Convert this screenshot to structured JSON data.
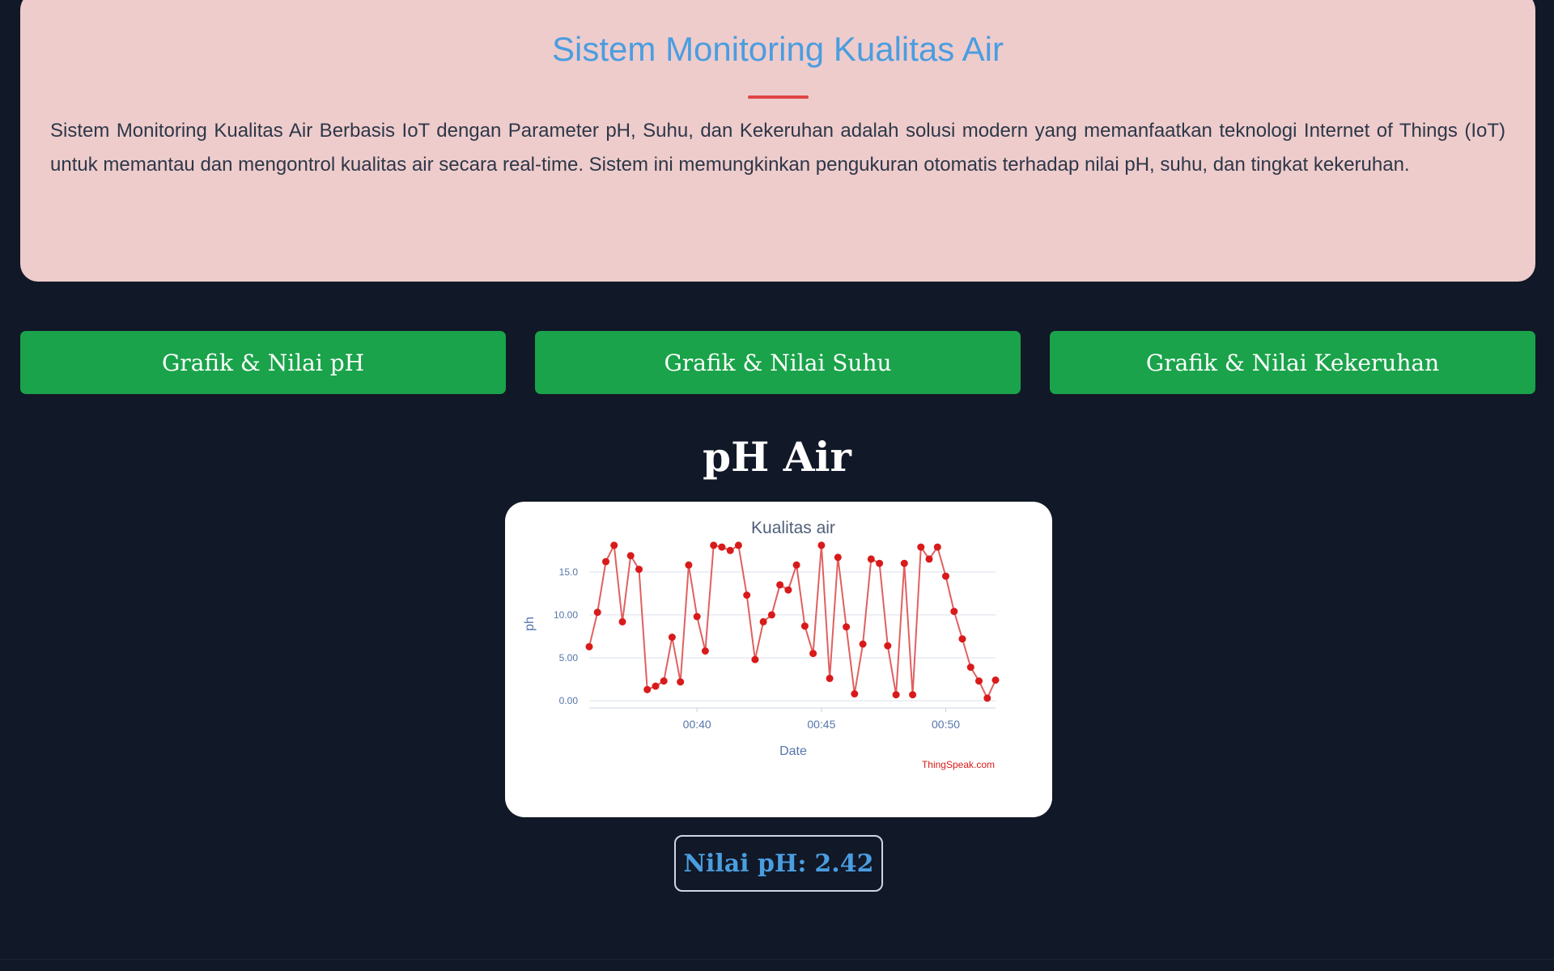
{
  "hero": {
    "title": "Sistem Monitoring Kualitas Air",
    "description": "Sistem Monitoring Kualitas Air Berbasis IoT dengan Parameter pH, Suhu, dan Kekeruhan adalah solusi modern yang memanfaatkan teknologi Internet of Things (IoT) untuk memantau dan mengontrol kualitas air secara real-time. Sistem ini memungkinkan pengukuran otomatis terhadap nilai pH, suhu, dan tingkat kekeruhan."
  },
  "tabs": [
    {
      "label": "Grafik & Nilai pH"
    },
    {
      "label": "Grafik & Nilai Suhu"
    },
    {
      "label": "Grafik & Nilai Kekeruhan"
    }
  ],
  "section": {
    "title": "pH Air"
  },
  "value": {
    "label": "Nilai pH:",
    "reading": "2.42"
  },
  "chart_data": {
    "type": "line",
    "title": "Kualitas air",
    "xlabel": "Date",
    "ylabel": "ph",
    "credit": "ThingSpeak.com",
    "line_color": "#e06060",
    "marker_color": "#d91a1a",
    "grid": true,
    "ylim": [
      0,
      18
    ],
    "yticks": [
      0,
      5,
      10,
      15
    ],
    "ytick_labels": [
      "0.00",
      "5.00",
      "10.00",
      "15.0"
    ],
    "xlim": [
      "00:35:40",
      "00:52:00"
    ],
    "xticks": [
      "00:40:00",
      "00:45:00",
      "00:50:00"
    ],
    "xtick_labels": [
      "00:40",
      "00:45",
      "00:50"
    ],
    "series": [
      {
        "x": [
          "00:35:40",
          "00:36:00",
          "00:36:20",
          "00:36:40",
          "00:37:00",
          "00:37:20",
          "00:37:40",
          "00:38:00",
          "00:38:20",
          "00:38:40",
          "00:39:00",
          "00:39:20",
          "00:39:40",
          "00:40:00",
          "00:40:20",
          "00:40:40",
          "00:41:00",
          "00:41:20",
          "00:41:40",
          "00:42:00",
          "00:42:20",
          "00:42:40",
          "00:43:00",
          "00:43:20",
          "00:43:40",
          "00:44:00",
          "00:44:20",
          "00:44:40",
          "00:45:00",
          "00:45:20",
          "00:45:40",
          "00:46:00",
          "00:46:20",
          "00:46:40",
          "00:47:00",
          "00:47:20",
          "00:47:40",
          "00:48:00",
          "00:48:20",
          "00:48:40",
          "00:49:00",
          "00:49:20",
          "00:49:40",
          "00:50:00",
          "00:50:20",
          "00:50:40",
          "00:51:00",
          "00:51:20",
          "00:51:40",
          "00:52:00"
        ],
        "y": [
          6.3,
          10.3,
          16.2,
          18.1,
          9.2,
          16.9,
          15.3,
          1.3,
          1.7,
          2.3,
          7.4,
          2.2,
          15.8,
          9.8,
          5.8,
          18.1,
          17.9,
          17.5,
          18.1,
          12.3,
          4.8,
          9.2,
          10.0,
          13.5,
          12.9,
          15.8,
          8.7,
          5.5,
          18.1,
          2.6,
          16.7,
          8.6,
          0.8,
          6.6,
          16.5,
          16.0,
          6.4,
          0.7,
          16.0,
          0.7,
          17.9,
          16.5,
          17.9,
          14.5,
          10.4,
          7.2,
          3.9,
          2.3,
          0.3,
          2.4
        ]
      }
    ]
  }
}
